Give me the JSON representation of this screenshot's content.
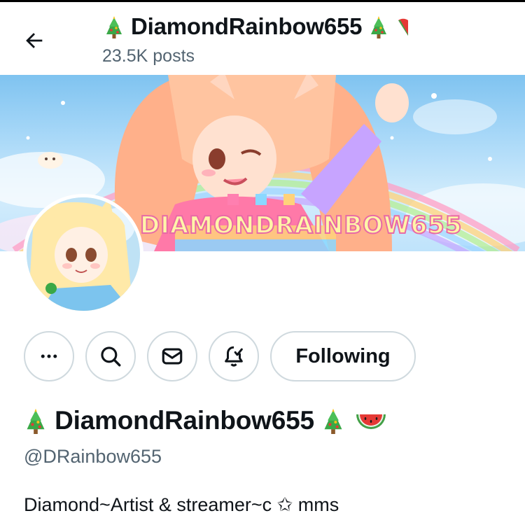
{
  "header": {
    "title": "DiamondRainbow655",
    "posts_count": "23.5K posts"
  },
  "banner": {
    "text": "DIAMONDRAINBOW655"
  },
  "actions": {
    "following_label": "Following"
  },
  "profile": {
    "display_name": "DiamondRainbow655",
    "handle": "@DRainbow655",
    "bio": "Diamond~Artist & streamer~c ✩ mms"
  },
  "icons": [
    "back-arrow-icon",
    "christmas-tree-icon",
    "watermelon-icon",
    "more-icon",
    "search-icon",
    "mail-icon",
    "notification-bell-icon"
  ]
}
